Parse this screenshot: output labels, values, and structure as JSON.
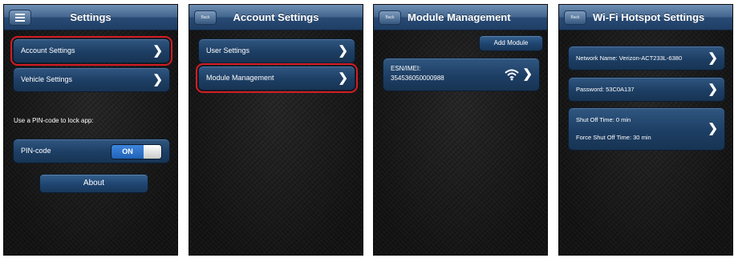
{
  "screens": [
    {
      "title": "Settings",
      "rows": [
        "Account Settings",
        "Vehicle Settings"
      ],
      "pin_prompt": "Use a PIN-code to lock app:",
      "pin_label": "PIN-code",
      "pin_state": "ON",
      "about": "About"
    },
    {
      "title": "Account Settings",
      "back": "Back",
      "rows": [
        "User Settings",
        "Module Management"
      ]
    },
    {
      "title": "Module Management",
      "back": "Back",
      "add_button": "Add Module",
      "module_label": "ESN/IMEI:",
      "module_value": "354536050000988"
    },
    {
      "title": "Wi-Fi Hotspot Settings",
      "back": "Back",
      "network_name": "Network Name: Verizon-ACT233L-6380",
      "password": "Password: 53C0A137",
      "shut_off": "Shut Off Time: 0 min",
      "force_shut_off": "Force Shut Off Time: 30 min"
    }
  ],
  "colors": {
    "nav": "#3b5f88",
    "cell": "#234a74",
    "highlight": "#d41d24",
    "toggle_on": "#2f72cc"
  },
  "icons": [
    "menu-icon",
    "chevron-right-icon",
    "wifi-icon"
  ]
}
